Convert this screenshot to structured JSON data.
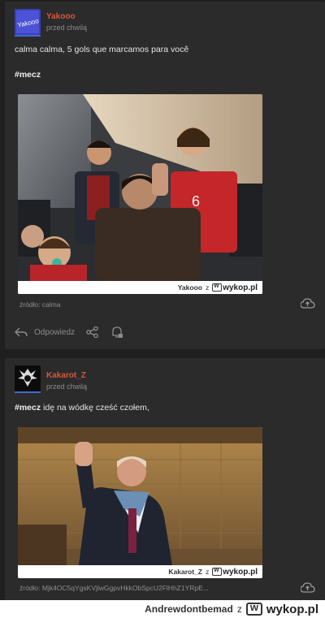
{
  "posts": [
    {
      "username": "Yakooo",
      "time": "przed chwilą",
      "avatar_text": "Yakooo",
      "text": "calma calma, 5 gols que marcamos para você",
      "tag": "#mecz",
      "media_caption_user": "Yakooo",
      "media_caption_z": "z",
      "wykop_label": "wykop.pl",
      "source": "źródło: calma",
      "actions": {
        "reply_label": "Odpowiedz"
      },
      "icons": [
        "reply-icon",
        "share-icon",
        "notification-icon",
        "upload-icon"
      ]
    },
    {
      "username": "Kakarot_Z",
      "time": "przed chwilą",
      "tag": "#mecz",
      "text": " idę na wódkę cześć czołem,",
      "media_caption_user": "Kakarot_Z",
      "media_caption_z": "z",
      "wykop_label": "wykop.pl",
      "source": "źródło: Mjk4OC5qYgsKVjlwGgpvHkkObSpcU2FlHhZ1YRpE...",
      "icons": [
        "upload-icon"
      ]
    }
  ],
  "footer": {
    "user": "Andrewdontbemad",
    "z": "z",
    "wykop_label": "wykop.pl"
  },
  "colors": {
    "background": "#1f1f20",
    "card": "#2b2b2c",
    "username": "#d5583a",
    "accent": "#3d6bd6"
  }
}
